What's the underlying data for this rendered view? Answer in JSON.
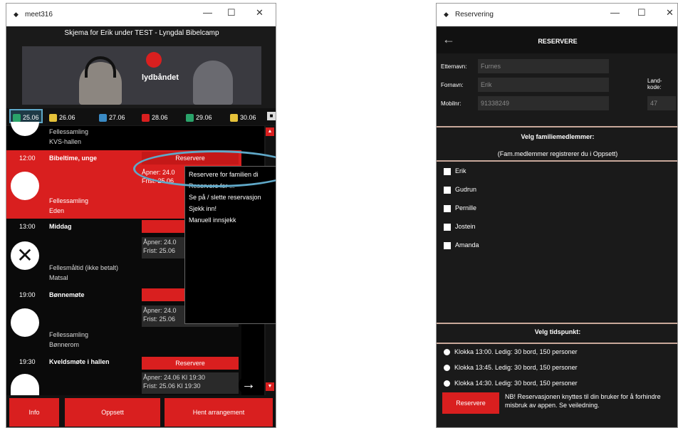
{
  "win1": {
    "title": "meet316",
    "header": "Skjema for Erik under TEST - Lyngdal Bibelcamp",
    "banner_logo": "lydbåndet",
    "dates": [
      "25.06",
      "26.06",
      "27.06",
      "28.06",
      "29.06",
      "30.06"
    ],
    "top_item": {
      "line1": "Fellessamling",
      "line2": "KVS-hallen"
    },
    "e1": {
      "time": "12:00",
      "title": "Bibeltime, unge",
      "btn": "Reservere",
      "opens": "Åpner: 24.0",
      "deadline": "Frist: 25.06",
      "sub1": "Fellessamling",
      "sub2": "Eden"
    },
    "e2": {
      "time": "13:00",
      "title": "Middag",
      "btn": "Re",
      "opens": "Åpner: 24.0",
      "deadline": "Frist: 25.06",
      "sub1": "Fellesmåltid (ikke betalt)",
      "sub2": "Matsal"
    },
    "e3": {
      "time": "19:00",
      "title": "Bønnemøte",
      "btn": "Re",
      "opens": "Åpner: 24.0",
      "deadline": "Frist: 25.06",
      "sub1": "Fellessamling",
      "sub2": "Bønnerom"
    },
    "e4": {
      "time": "19:30",
      "title": "Kveldsmøte i hallen",
      "btn": "Reservere",
      "opens": "Åpner: 24.06 Kl 19:30",
      "deadline": "Frist: 25.06 Kl 19:30"
    },
    "menu": [
      "Reservere for familien di",
      "Reservere for ...",
      "Se på / slette reservasjon",
      "Sjekk inn!",
      "Manuell innsjekk"
    ],
    "footer": [
      "Info",
      "Oppsett",
      "Hent arrangement"
    ]
  },
  "win2": {
    "title": "Reservering",
    "header": "RESERVERE",
    "etternavn_label": "Etternavn:",
    "etternavn": "Furnes",
    "fornavn_label": "Fornavn:",
    "fornavn": "Erik",
    "mobil_label": "Mobilnr:",
    "mobil": "91338249",
    "land_label": "Land-kode:",
    "land": "47",
    "family_title": "Velg familiemedlemmer:",
    "family_sub": "(Fam.medlemmer registrerer du i Oppsett)",
    "members": [
      "Erik",
      "Gudrun",
      "Pernille",
      "Jostein",
      "Amanda"
    ],
    "time_title": "Velg tidspunkt:",
    "slots": [
      "Klokka 13:00. Ledig: 30 bord, 150 personer",
      "Klokka 13:45. Ledig: 30 bord, 150 personer",
      "Klokka 14:30. Ledig: 30 bord, 150 personer"
    ],
    "btn": "Reservere",
    "note": "NB! Reservasjonen knyttes til din bruker for å forhindre misbruk av appen. Se veiledning."
  },
  "colors": {
    "red": "#d91f1f",
    "teal": "#5fa8c8"
  }
}
